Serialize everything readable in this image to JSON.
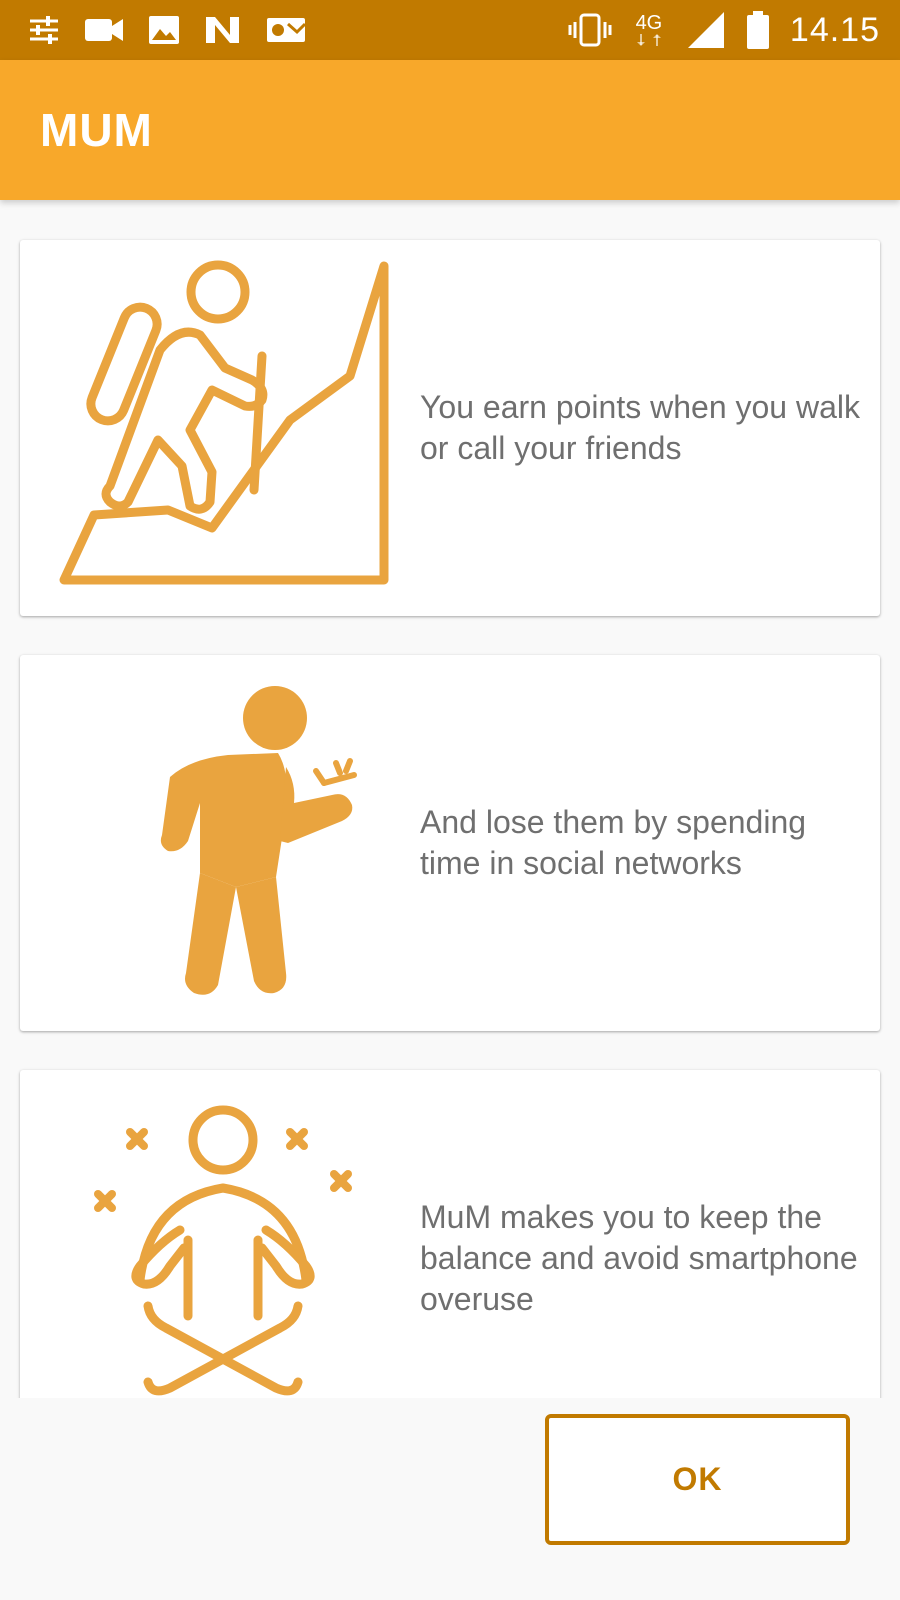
{
  "status_bar": {
    "network": "4G",
    "time": "14.15",
    "icons_left": [
      "tune-icon",
      "video-camera-icon",
      "image-icon",
      "n-app-icon",
      "outlook-icon"
    ],
    "icons_right": [
      "vibrate-icon",
      "network-4g-icon",
      "signal-icon",
      "battery-icon"
    ]
  },
  "app_bar": {
    "title": "MUM"
  },
  "cards": [
    {
      "text": "You earn points when you walk or call your friends",
      "icon": "hiker-climbing-icon"
    },
    {
      "text": "And lose them by spending time in social networks",
      "icon": "person-using-phone-icon"
    },
    {
      "text": "MuM makes you to keep the balance and avoid smartphone overuse",
      "icon": "meditation-icon"
    }
  ],
  "ok_button": {
    "label": "OK"
  },
  "colors": {
    "status_bar": "#c17a00",
    "app_bar": "#f8a82a",
    "illustration": "#e9a43f",
    "ok_button": "#c17a00",
    "text": "#6f6f6f"
  }
}
